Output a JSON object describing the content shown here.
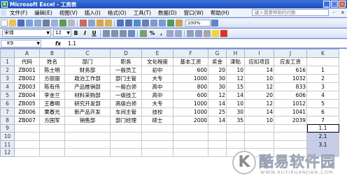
{
  "window": {
    "title": "Microsoft Excel - 工资表",
    "app_icon": "X",
    "minimize_label": "_",
    "maximize_label": "□",
    "close_label": "×"
  },
  "menu": {
    "items": [
      "文件(F)",
      "编辑(E)",
      "视图(V)",
      "插入(I)",
      "格式(O)",
      "工具(T)",
      "数据(D)",
      "窗口(W)",
      "帮助(H)"
    ],
    "help_placeholder": "键入需要帮助的问题",
    "minimize_label": "-",
    "close_label": "×"
  },
  "toolbar": {
    "zoom": "100%",
    "font_name": "宋体",
    "font_size": "12",
    "bold_label": "B",
    "italic_label": "I",
    "underline_label": "U",
    "percent_label": "%",
    "comma_label": ","
  },
  "formula_bar": {
    "cell_ref": "K9",
    "fx_label": "fx",
    "value": "1.1"
  },
  "grid": {
    "column_letters": [
      "A",
      "B",
      "C",
      "D",
      "E",
      "F",
      "G",
      "H",
      "I",
      "J",
      "K"
    ],
    "row_numbers": [
      "1",
      "2",
      "3",
      "4",
      "5",
      "6",
      "7",
      "8",
      "9",
      "10",
      "11",
      "12"
    ],
    "headers": [
      "代码",
      "姓名",
      "部门",
      "职务",
      "文化程度",
      "基本工资",
      "奖金",
      "津贴",
      "应扣项目",
      "应发工资"
    ],
    "rows": [
      [
        "ZB001",
        "陈士明",
        "财务部",
        "一般员工",
        "初中",
        "600",
        "20",
        "10",
        "14",
        "616",
        "1"
      ],
      [
        "ZB002",
        "方丽丽",
        "政治工作部",
        "部门主管",
        "大专",
        "1000",
        "30",
        "12",
        "10",
        "1032",
        "2"
      ],
      [
        "ZB003",
        "陈有伟",
        "产品推销部",
        "一般白领",
        "高中",
        "800",
        "30",
        "15",
        "12",
        "833",
        "3"
      ],
      [
        "ZB004",
        "李金兰",
        "材料采购部",
        "一级技工",
        "高中",
        "600",
        "12",
        "14",
        "20",
        "606",
        "4"
      ],
      [
        "ZB005",
        "王春明",
        "研究开发部",
        "高级白领",
        "大专",
        "1000",
        "14",
        "10",
        "12",
        "1012",
        "5"
      ],
      [
        "ZB006",
        "栗春光",
        "新产品开发",
        "车间主管",
        "技校",
        "1000",
        "25",
        "30",
        "14",
        "1041",
        "6"
      ],
      [
        "ZB007",
        "方国军",
        "销售部",
        "部门经理",
        "硕士",
        "2000",
        "14",
        "35",
        "10",
        "2039",
        "7"
      ]
    ],
    "k_values": [
      "1.1",
      "2.1",
      "3.1"
    ]
  },
  "watermark": {
    "logo": "K",
    "brand": "酷易软件园",
    "url": "WWW.KUYIRUANJIAN.COM"
  },
  "colors": {
    "title_bar": "#1c4dbd",
    "selection": "#c5cde9",
    "header_bg": "#e9edf6"
  }
}
